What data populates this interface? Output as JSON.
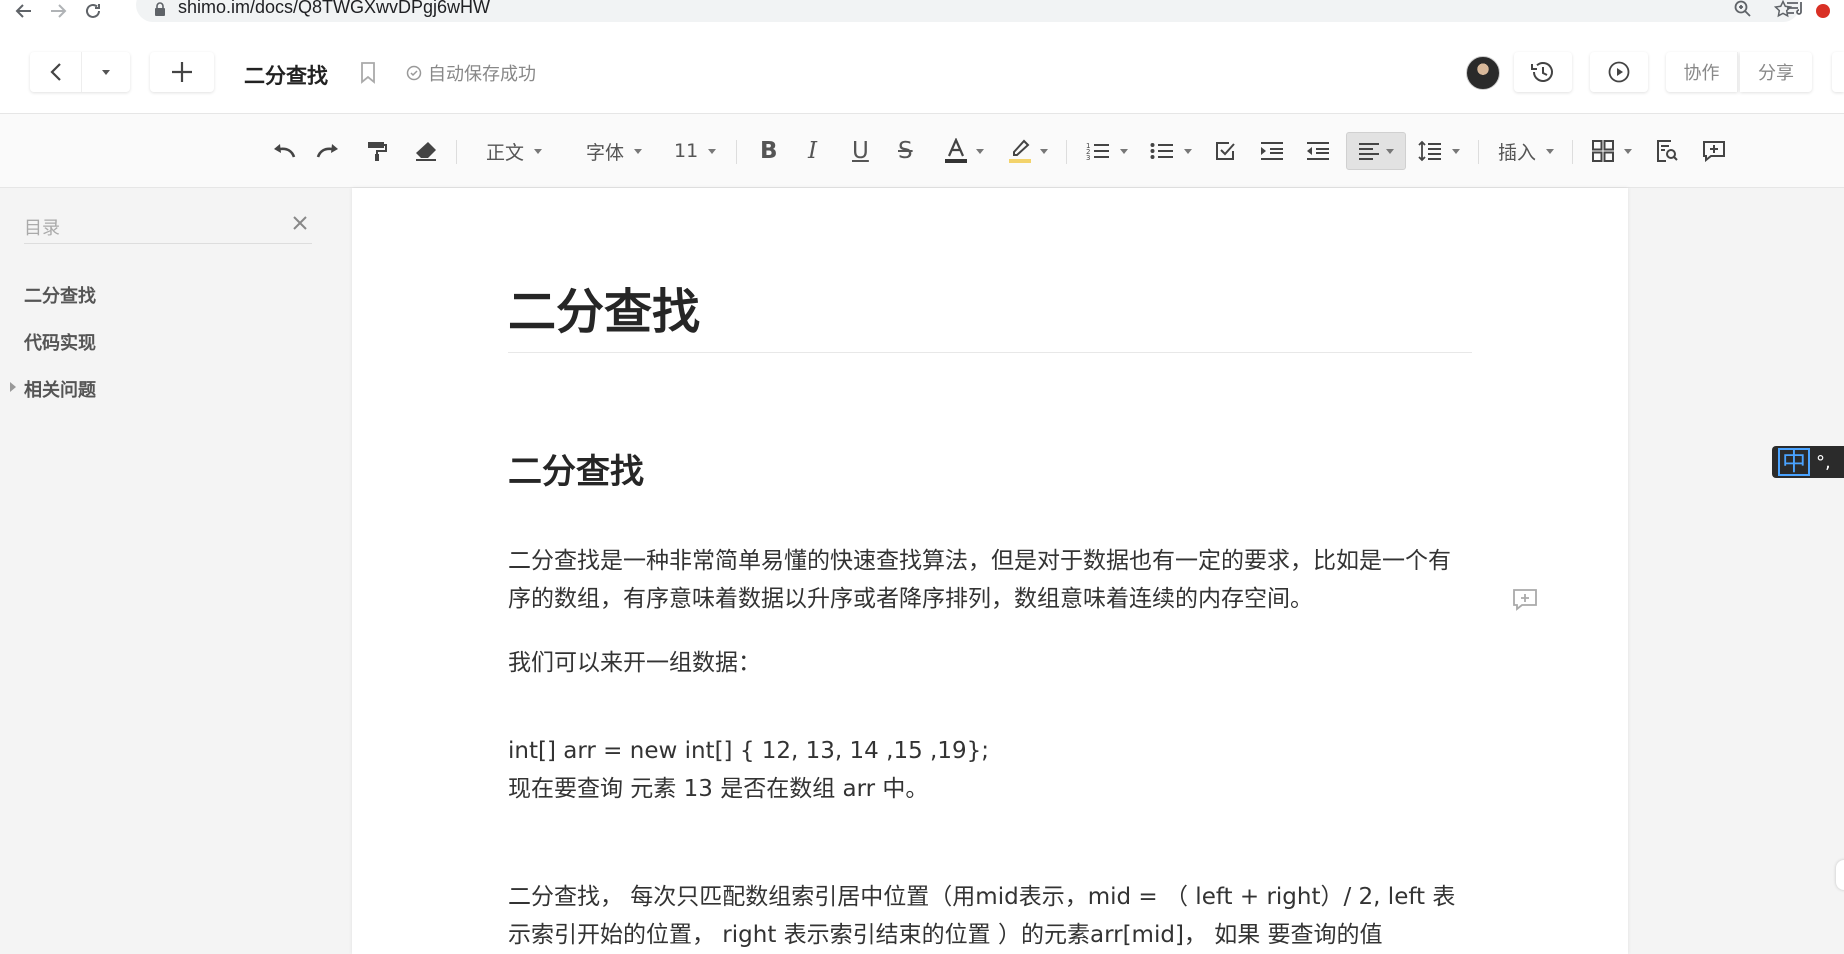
{
  "browser": {
    "url": "shimo.im/docs/Q8TWGXwvDPgj6wHW"
  },
  "header": {
    "doc_title": "二分查找",
    "autosave_text": "自动保存成功",
    "collaborate_label": "协作",
    "share_label": "分享"
  },
  "toolbar": {
    "paragraph_style": "正文",
    "font_family": "字体",
    "font_size": "11",
    "insert_label": "插入"
  },
  "sidebar": {
    "title": "目录",
    "items": [
      {
        "label": "二分查找"
      },
      {
        "label": "代码实现"
      },
      {
        "label": "相关问题"
      }
    ]
  },
  "document": {
    "title": "二分查找",
    "heading": "二分查找",
    "paragraphs": [
      "二分查找是一种非常简单易懂的快速查找算法，但是对于数据也有一定的要求，比如是一个有序的数组，有序意味着数据以升序或者降序排列，数组意味着连续的内存空间。",
      "我们可以来开一组数据：",
      " int[] arr = new int[] { 12, 13, 14 ,15 ,19};",
      " 现在要查询 元素 13 是否在数组 arr 中。",
      "二分查找， 每次只匹配数组索引居中位置（用mid表示，mid = （ left + right）/ 2, left  表示索引开始的位置， right 表示索引结束的位置 ）的元素arr[mid]， 如果 要查询的值"
    ]
  },
  "ime": {
    "mode": "中",
    "punct": "°,"
  },
  "colors": {
    "accent_blue": "#4aa3ff",
    "text_dark": "#262626",
    "sidebar_bg": "#f4f4f4"
  }
}
